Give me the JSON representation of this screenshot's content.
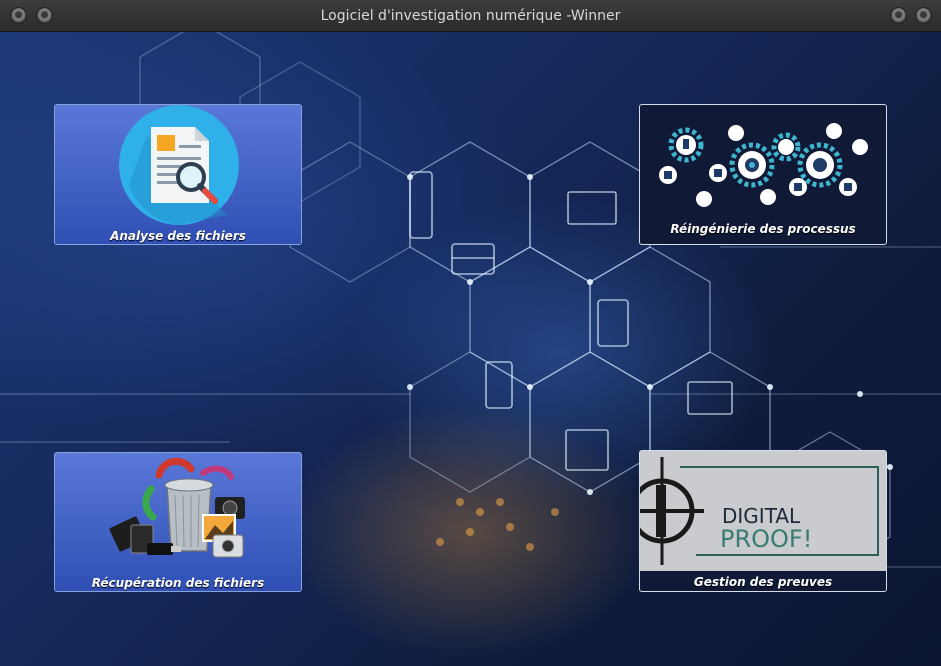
{
  "window": {
    "title": "Logiciel d'investigation numérique -Winner"
  },
  "tiles": [
    {
      "label": "Analyse des fichiers",
      "icon": "document-search-icon"
    },
    {
      "label": "Réingénierie des processus",
      "icon": "process-gears-icon"
    },
    {
      "label": "Récupération des fichiers",
      "icon": "file-recovery-icon"
    },
    {
      "label": "Gestion des preuves",
      "icon": "digital-proof-logo"
    }
  ],
  "digital_proof_logo": {
    "line1": "DIGITAL",
    "line2": "PROOF!"
  },
  "colors": {
    "tile_blue": "#4a68d0",
    "tile_dark": "#101a36",
    "titlebar": "#333333",
    "accent_cyan": "#9fe6f5"
  }
}
